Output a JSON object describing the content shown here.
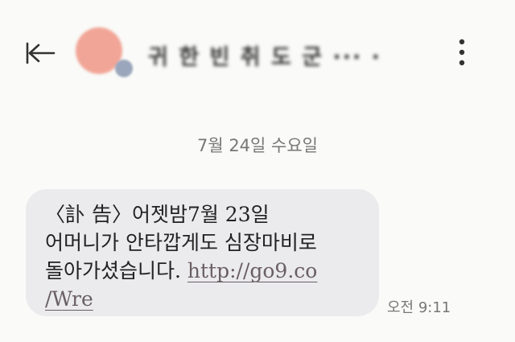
{
  "header": {
    "back_icon": "back-arrow-icon",
    "contact_name": "귀 한 빈 취 도 군 ··· ·",
    "menu_icon": "more-vertical-icon"
  },
  "date_divider": "7월 24일 수요일",
  "message": {
    "line1": "〈訃 告〉어젯밤7월 23일",
    "line2": "어머니가 안타깝게도 심장마비로",
    "line3_text": "돌아가셨습니다. ",
    "link_part1": "http://go9.co",
    "link_part2": "/Wre",
    "time": "오전 9:11"
  },
  "colors": {
    "background": "#fafaf8",
    "bubble": "#ebebee",
    "link": "#6a5f62",
    "secondary_text": "#777777",
    "avatar": "#f1a596"
  }
}
